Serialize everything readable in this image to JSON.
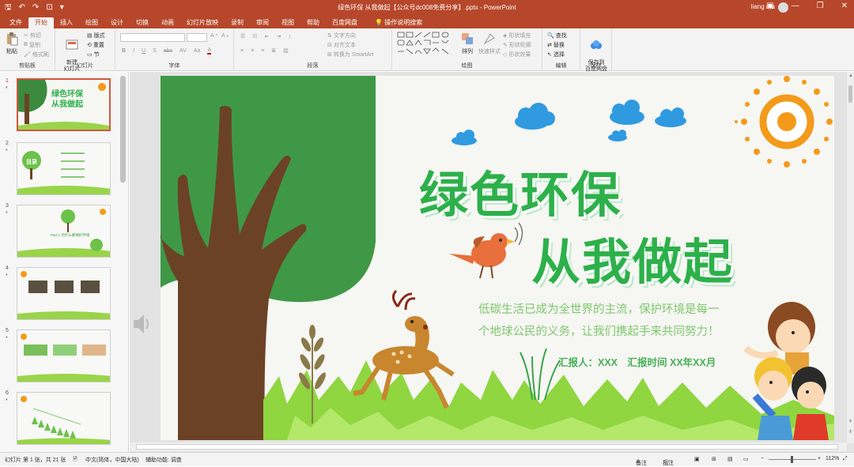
{
  "window": {
    "title": "绿色环保 从我做起【公众号dc008免费分享】.pptx - PowerPoint",
    "user": "liang ma"
  },
  "tabs": [
    "文件",
    "开始",
    "插入",
    "绘图",
    "设计",
    "切换",
    "动画",
    "幻灯片放映",
    "录制",
    "审阅",
    "视图",
    "帮助",
    "百度网盘"
  ],
  "tell_me": "操作说明搜索",
  "ribbon": {
    "clipboard": {
      "label": "剪贴板",
      "paste": "粘贴",
      "cut": "剪切",
      "copy": "复制",
      "format_painter": "格式刷"
    },
    "slides": {
      "label": "幻灯片",
      "new_slide": "新建\n幻灯片",
      "layout": "版式",
      "reset": "重置",
      "section": "节"
    },
    "font": {
      "label": "字体"
    },
    "paragraph": {
      "label": "段落",
      "text_direction": "文字方向",
      "align_text": "对齐文本",
      "smartart": "转换为 SmartArt"
    },
    "drawing": {
      "label": "绘图",
      "arrange": "排列",
      "quick_styles": "快速样式",
      "shape_fill": "形状填充",
      "shape_outline": "形状轮廓",
      "shape_effects": "形状效果"
    },
    "editing": {
      "label": "编辑",
      "find": "查找",
      "replace": "替换",
      "select": "选择"
    },
    "save": {
      "label": "保存",
      "save_to": "保存到\n百度网盘"
    }
  },
  "thumbnails": [
    {
      "num": "1",
      "caption": "绿色环保\n从我做起"
    },
    {
      "num": "2",
      "caption": "目录"
    },
    {
      "num": "3",
      "caption": "Part 1 为什么要保护环境"
    },
    {
      "num": "4",
      "caption": ""
    },
    {
      "num": "5",
      "caption": ""
    },
    {
      "num": "6",
      "caption": ""
    }
  ],
  "slide": {
    "title_line1": "绿色环保",
    "title_line2": "从我做起",
    "subtitle_line1": "低碳生活已成为全世界的主流，保护环境是每一",
    "subtitle_line2": "个地球公民的义务，让我们携起手来共同努力！",
    "reporter": "汇报人：XXX　汇报时间 XX年XX月"
  },
  "status": {
    "slide_info": "幻灯片 第 1 张，共 21 张",
    "language": "中文(简体，中国大陆)",
    "accessibility": "辅助功能: 调查",
    "notes": "备注",
    "comments": "批注",
    "zoom": "112%"
  },
  "colors": {
    "accent": "#b7472a",
    "title_green": "#2db04a",
    "sub_green": "#7ec86c"
  }
}
